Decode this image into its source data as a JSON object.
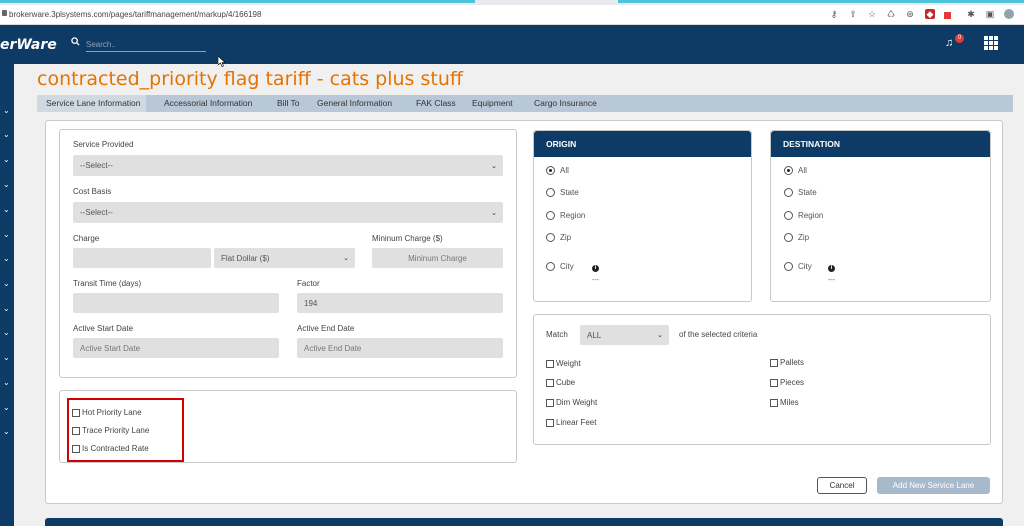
{
  "browser": {
    "url": "brokerware.3plsystems.com/pages/tariffmanagement/markup/4/166198"
  },
  "header": {
    "brand": "erWare",
    "search_placeholder": "Search..",
    "notification_count": "0"
  },
  "page": {
    "title": "contracted_priority flag tariff - cats plus stuff"
  },
  "tabs": [
    {
      "label": "Service Lane Information",
      "active": true
    },
    {
      "label": "Accessorial Information"
    },
    {
      "label": "Bill To"
    },
    {
      "label": "General Information"
    },
    {
      "label": "FAK Class"
    },
    {
      "label": "Equipment"
    },
    {
      "label": "Cargo Insurance"
    }
  ],
  "form": {
    "service_provided_label": "Service Provided",
    "service_provided_value": "--Select--",
    "cost_basis_label": "Cost Basis",
    "cost_basis_value": "--Select--",
    "charge_label": "Charge",
    "charge_type_value": "Flat Dollar ($)",
    "min_charge_label": "Mininum Charge ($)",
    "min_charge_placeholder": "Mininum Charge",
    "transit_time_label": "Transit Time (days)",
    "factor_label": "Factor",
    "factor_value": "194",
    "active_start_label": "Active Start Date",
    "active_start_placeholder": "Active Start Date",
    "active_end_label": "Active End Date",
    "active_end_placeholder": "Active End Date"
  },
  "flags": [
    {
      "label": "Hot Priority Lane"
    },
    {
      "label": "Trace Priority Lane"
    },
    {
      "label": "Is Contracted Rate"
    }
  ],
  "origin": {
    "title": "ORIGIN",
    "options": [
      "All",
      "State",
      "Region",
      "Zip",
      "City"
    ],
    "selected": "All",
    "city_value": "---"
  },
  "destination": {
    "title": "DESTINATION",
    "options": [
      "All",
      "State",
      "Region",
      "Zip",
      "City"
    ],
    "selected": "All",
    "city_value": "---"
  },
  "criteria": {
    "match_label": "Match",
    "match_value": "ALL",
    "suffix_label": "of the selected criteria",
    "left": [
      "Weight",
      "Cube",
      "Dim Weight",
      "Linear Feet"
    ],
    "right": [
      "Pallets",
      "Pieces",
      "Miles"
    ]
  },
  "actions": {
    "cancel_label": "Cancel",
    "add_label": "Add New Service Lane"
  },
  "colors": {
    "navy": "#0e3a66",
    "title_orange": "#e57300",
    "highlight_red": "#d40000"
  }
}
